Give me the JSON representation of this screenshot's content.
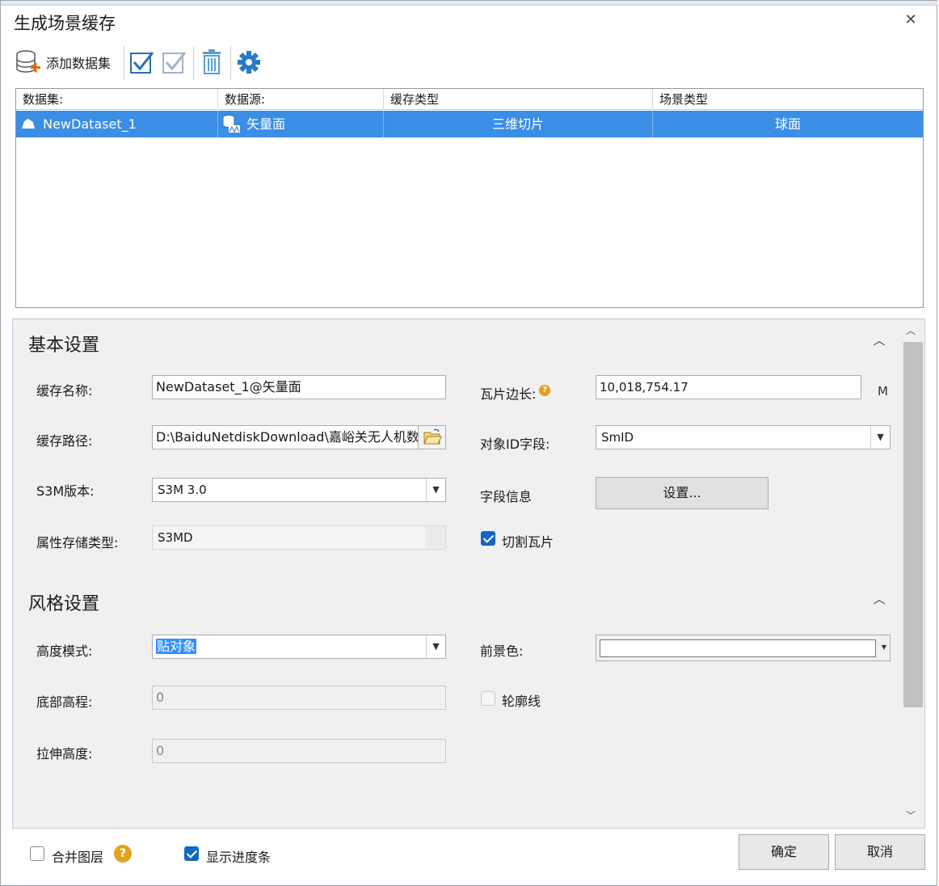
{
  "dialog": {
    "title": "生成场景缓存",
    "close_symbol": "✕"
  },
  "toolbar": {
    "add_dataset_label": "添加数据集"
  },
  "grid": {
    "columns": [
      "数据集:",
      "数据源:",
      "缓存类型",
      "场景类型"
    ],
    "rows": [
      {
        "dataset": "NewDataset_1",
        "datasource": "矢量面",
        "cache_type": "三维切片",
        "scene_type": "球面"
      }
    ]
  },
  "basic": {
    "title": "基本设置",
    "cache_name_label": "缓存名称:",
    "cache_name_value": "NewDataset_1@矢量面",
    "cache_path_label": "缓存路径:",
    "cache_path_value": "D:\\BaiduNetdiskDownload\\嘉峪关无人机数",
    "s3m_version_label": "S3M版本:",
    "s3m_version_value": "S3M 3.0",
    "attr_storage_label": "属性存储类型:",
    "attr_storage_value": "S3MD",
    "tile_side_label": "瓦片边长:",
    "tile_side_value": "10,018,754.17",
    "tile_side_unit": "M",
    "object_id_label": "对象ID字段:",
    "object_id_value": "SmID",
    "field_info_label": "字段信息",
    "field_info_button": "设置...",
    "cut_tiles_label": "切割瓦片",
    "cut_tiles_checked": true
  },
  "style": {
    "title": "风格设置",
    "height_mode_label": "高度模式:",
    "height_mode_value": "贴对象",
    "bottom_height_label": "底部高程:",
    "bottom_height_value": "0",
    "extrude_height_label": "拉伸高度:",
    "extrude_height_value": "0",
    "foreground_label": "前景色:",
    "outline_label": "轮廓线",
    "outline_checked": false
  },
  "footer": {
    "merge_layers_label": "合并图层",
    "merge_layers_checked": false,
    "show_progress_label": "显示进度条",
    "show_progress_checked": true,
    "ok_label": "确定",
    "cancel_label": "取消"
  },
  "colors": {
    "selection": "#3a8ee6",
    "accent": "#1466c3",
    "panel_bg": "#f0f0f0",
    "help_icon": "#e3a21a"
  },
  "icons": [
    "database-add-icon",
    "check-all-icon",
    "uncheck-all-icon",
    "delete-icon",
    "settings-gear-icon",
    "region-dataset-icon",
    "vector-datasource-icon",
    "folder-open-icon",
    "help-icon",
    "collapse-icon"
  ]
}
